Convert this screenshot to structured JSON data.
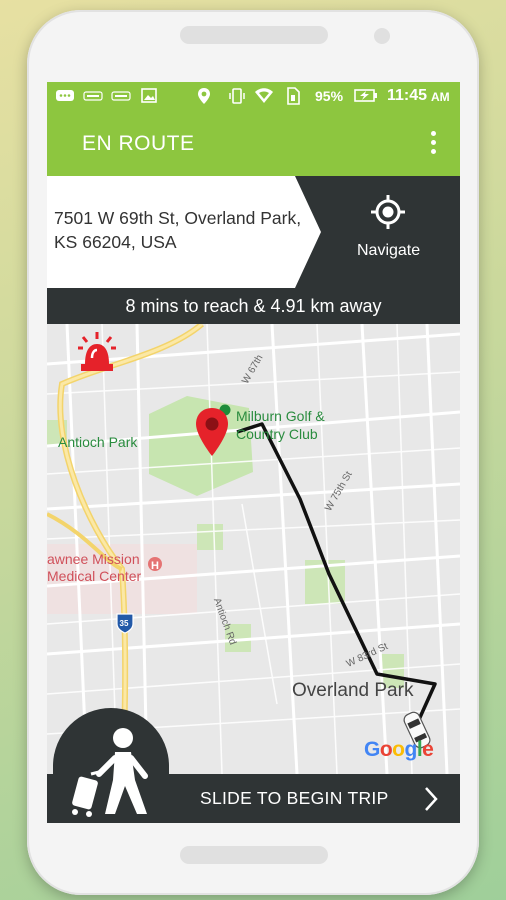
{
  "status": {
    "battery": "95%",
    "time": "11:45",
    "ampm": "AM",
    "icons": [
      "chat-icon",
      "volte-icon",
      "volte-icon",
      "image-icon",
      "location-icon",
      "vibrate-icon",
      "wifi-icon",
      "sim-icon",
      "battery-charging-icon"
    ]
  },
  "appbar": {
    "title": "EN ROUTE",
    "menu_icon": "more-vert-icon"
  },
  "destination": {
    "address": "7501 W 69th St, Overland Park, KS 66204, USA",
    "navigate_label": "Navigate",
    "navigate_icon": "gps-target-icon"
  },
  "eta": {
    "text": "8 mins to reach & 4.91 km away"
  },
  "map": {
    "labels": {
      "antioch": "Antioch Park",
      "milburn1": "Milburn Golf &",
      "milburn2": "Country Club",
      "shawnee1": "awnee Mission",
      "shawnee2": "Medical Center",
      "overland": "Overland Park",
      "antioch_rd": "Antioch Rd",
      "w83rd": "W 83rd St",
      "w75th": "W 75th St",
      "w67th": "W 67th",
      "interstate": "35",
      "google": [
        "G",
        "o",
        "o",
        "g",
        "l",
        "e"
      ]
    },
    "siren_icon": "emergency-siren-icon",
    "pin_icon": "destination-pin-icon",
    "vehicle_icon": "car-icon"
  },
  "slider": {
    "label": "SLIDE TO BEGIN TRIP",
    "chevron_icon": "chevron-right-icon",
    "walker_icon": "traveler-luggage-icon"
  },
  "colors": {
    "accent": "#8dc63f",
    "dark": "#2f3435",
    "route": "#111111",
    "pin": "#e5222a"
  }
}
